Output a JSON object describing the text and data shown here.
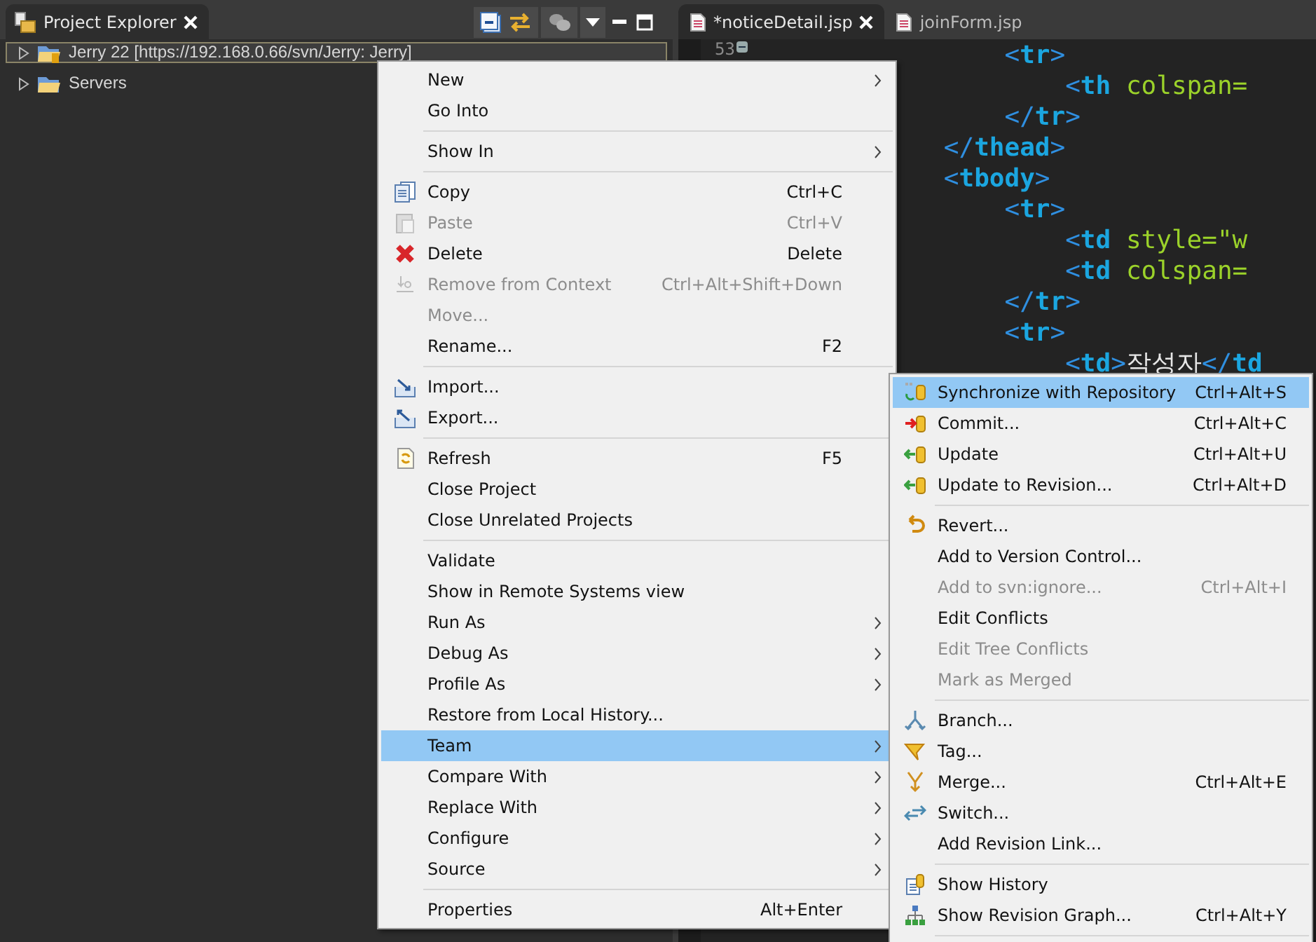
{
  "explorer": {
    "title": "Project Explorer",
    "tree": [
      {
        "label": "Jerry 22 [https://192.168.0.66/svn/Jerry: Jerry]",
        "selected": true,
        "expanded": false
      },
      {
        "label": "Servers",
        "selected": false,
        "expanded": false
      }
    ]
  },
  "editor": {
    "tabs": [
      {
        "label": "*noticeDetail.jsp",
        "selected": true
      },
      {
        "label": "joinForm.jsp",
        "selected": false
      }
    ],
    "line_number": "53",
    "lines": [
      [
        {
          "kind": "punct",
          "text": "                    <"
        },
        {
          "kind": "tag",
          "text": "tr"
        },
        {
          "kind": "punct",
          "text": ">"
        }
      ],
      [
        {
          "kind": "punct",
          "text": "                        <"
        },
        {
          "kind": "tag",
          "text": "th"
        },
        {
          "kind": "attr",
          "text": " colspan="
        }
      ],
      [
        {
          "kind": "punct",
          "text": "                    </"
        },
        {
          "kind": "tag",
          "text": "tr"
        },
        {
          "kind": "punct",
          "text": ">"
        }
      ],
      [
        {
          "kind": "punct",
          "text": "                </"
        },
        {
          "kind": "tag",
          "text": "thead"
        },
        {
          "kind": "punct",
          "text": ">"
        }
      ],
      [
        {
          "kind": "punct",
          "text": "                <"
        },
        {
          "kind": "tag",
          "text": "tbody"
        },
        {
          "kind": "punct",
          "text": ">"
        }
      ],
      [
        {
          "kind": "punct",
          "text": "                    <"
        },
        {
          "kind": "tag",
          "text": "tr"
        },
        {
          "kind": "punct",
          "text": ">"
        }
      ],
      [
        {
          "kind": "punct",
          "text": "                        <"
        },
        {
          "kind": "tag",
          "text": "td"
        },
        {
          "kind": "attr",
          "text": " style=\"w"
        }
      ],
      [
        {
          "kind": "punct",
          "text": "                        <"
        },
        {
          "kind": "tag",
          "text": "td"
        },
        {
          "kind": "attr",
          "text": " colspan="
        }
      ],
      [
        {
          "kind": "punct",
          "text": "                    </"
        },
        {
          "kind": "tag",
          "text": "tr"
        },
        {
          "kind": "punct",
          "text": ">"
        }
      ],
      [
        {
          "kind": "punct",
          "text": "                    <"
        },
        {
          "kind": "tag",
          "text": "tr"
        },
        {
          "kind": "punct",
          "text": ">"
        }
      ],
      [
        {
          "kind": "punct",
          "text": "                        <"
        },
        {
          "kind": "tag",
          "text": "td"
        },
        {
          "kind": "punct",
          "text": ">"
        },
        {
          "kind": "text",
          "text": "작성자"
        },
        {
          "kind": "punct",
          "text": "</"
        },
        {
          "kind": "tag",
          "text": "td"
        }
      ]
    ]
  },
  "context_menu": {
    "items": [
      {
        "kind": "item",
        "label": "New",
        "submenu": true,
        "disabled": false,
        "selected": false
      },
      {
        "kind": "item",
        "label": "Go Into",
        "submenu": false,
        "disabled": false,
        "selected": false
      },
      {
        "kind": "separator"
      },
      {
        "kind": "item",
        "label": "Show In",
        "submenu": true,
        "disabled": false,
        "selected": false
      },
      {
        "kind": "separator"
      },
      {
        "kind": "item",
        "label": "Copy",
        "shortcut": "Ctrl+C",
        "submenu": false,
        "disabled": false,
        "selected": false
      },
      {
        "kind": "item",
        "label": "Paste",
        "shortcut": "Ctrl+V",
        "submenu": false,
        "disabled": true,
        "selected": false
      },
      {
        "kind": "item",
        "label": "Delete",
        "shortcut": "Delete",
        "submenu": false,
        "disabled": false,
        "selected": false
      },
      {
        "kind": "item",
        "label": "Remove from Context",
        "shortcut": "Ctrl+Alt+Shift+Down",
        "submenu": false,
        "disabled": true,
        "selected": false
      },
      {
        "kind": "item",
        "label": "Move...",
        "submenu": false,
        "disabled": true,
        "selected": false
      },
      {
        "kind": "item",
        "label": "Rename...",
        "shortcut": "F2",
        "submenu": false,
        "disabled": false,
        "selected": false
      },
      {
        "kind": "separator"
      },
      {
        "kind": "item",
        "label": "Import...",
        "submenu": false,
        "disabled": false,
        "selected": false
      },
      {
        "kind": "item",
        "label": "Export...",
        "submenu": false,
        "disabled": false,
        "selected": false
      },
      {
        "kind": "separator"
      },
      {
        "kind": "item",
        "label": "Refresh",
        "shortcut": "F5",
        "submenu": false,
        "disabled": false,
        "selected": false
      },
      {
        "kind": "item",
        "label": "Close Project",
        "submenu": false,
        "disabled": false,
        "selected": false
      },
      {
        "kind": "item",
        "label": "Close Unrelated Projects",
        "submenu": false,
        "disabled": false,
        "selected": false
      },
      {
        "kind": "separator"
      },
      {
        "kind": "item",
        "label": "Validate",
        "submenu": false,
        "disabled": false,
        "selected": false
      },
      {
        "kind": "item",
        "label": "Show in Remote Systems view",
        "submenu": false,
        "disabled": false,
        "selected": false
      },
      {
        "kind": "item",
        "label": "Run As",
        "submenu": true,
        "disabled": false,
        "selected": false
      },
      {
        "kind": "item",
        "label": "Debug As",
        "submenu": true,
        "disabled": false,
        "selected": false
      },
      {
        "kind": "item",
        "label": "Profile As",
        "submenu": true,
        "disabled": false,
        "selected": false
      },
      {
        "kind": "item",
        "label": "Restore from Local History...",
        "submenu": false,
        "disabled": false,
        "selected": false
      },
      {
        "kind": "item",
        "label": "Team",
        "submenu": true,
        "disabled": false,
        "selected": true
      },
      {
        "kind": "item",
        "label": "Compare With",
        "submenu": true,
        "disabled": false,
        "selected": false
      },
      {
        "kind": "item",
        "label": "Replace With",
        "submenu": true,
        "disabled": false,
        "selected": false
      },
      {
        "kind": "item",
        "label": "Configure",
        "submenu": true,
        "disabled": false,
        "selected": false
      },
      {
        "kind": "item",
        "label": "Source",
        "submenu": true,
        "disabled": false,
        "selected": false
      },
      {
        "kind": "separator"
      },
      {
        "kind": "item",
        "label": "Properties",
        "shortcut": "Alt+Enter",
        "submenu": false,
        "disabled": false,
        "selected": false
      }
    ]
  },
  "team_submenu": {
    "items": [
      {
        "kind": "item",
        "label": "Synchronize with Repository",
        "shortcut": "Ctrl+Alt+S",
        "disabled": false,
        "selected": true
      },
      {
        "kind": "item",
        "label": "Commit...",
        "shortcut": "Ctrl+Alt+C",
        "disabled": false,
        "selected": false
      },
      {
        "kind": "item",
        "label": "Update",
        "shortcut": "Ctrl+Alt+U",
        "disabled": false,
        "selected": false
      },
      {
        "kind": "item",
        "label": "Update to Revision...",
        "shortcut": "Ctrl+Alt+D",
        "disabled": false,
        "selected": false
      },
      {
        "kind": "separator"
      },
      {
        "kind": "item",
        "label": "Revert...",
        "disabled": false,
        "selected": false
      },
      {
        "kind": "item",
        "label": "Add to Version Control...",
        "disabled": false,
        "selected": false
      },
      {
        "kind": "item",
        "label": "Add to svn:ignore...",
        "shortcut": "Ctrl+Alt+I",
        "disabled": true,
        "selected": false
      },
      {
        "kind": "item",
        "label": "Edit Conflicts",
        "disabled": false,
        "selected": false
      },
      {
        "kind": "item",
        "label": "Edit Tree Conflicts",
        "disabled": true,
        "selected": false
      },
      {
        "kind": "item",
        "label": "Mark as Merged",
        "disabled": true,
        "selected": false
      },
      {
        "kind": "separator"
      },
      {
        "kind": "item",
        "label": "Branch...",
        "disabled": false,
        "selected": false
      },
      {
        "kind": "item",
        "label": "Tag...",
        "disabled": false,
        "selected": false
      },
      {
        "kind": "item",
        "label": "Merge...",
        "shortcut": "Ctrl+Alt+E",
        "disabled": false,
        "selected": false
      },
      {
        "kind": "item",
        "label": "Switch...",
        "disabled": false,
        "selected": false
      },
      {
        "kind": "item",
        "label": "Add Revision Link...",
        "disabled": false,
        "selected": false
      },
      {
        "kind": "separator"
      },
      {
        "kind": "item",
        "label": "Show History",
        "disabled": false,
        "selected": false
      },
      {
        "kind": "item",
        "label": "Show Revision Graph...",
        "shortcut": "Ctrl+Alt+Y",
        "disabled": false,
        "selected": false
      },
      {
        "kind": "separator"
      }
    ]
  }
}
